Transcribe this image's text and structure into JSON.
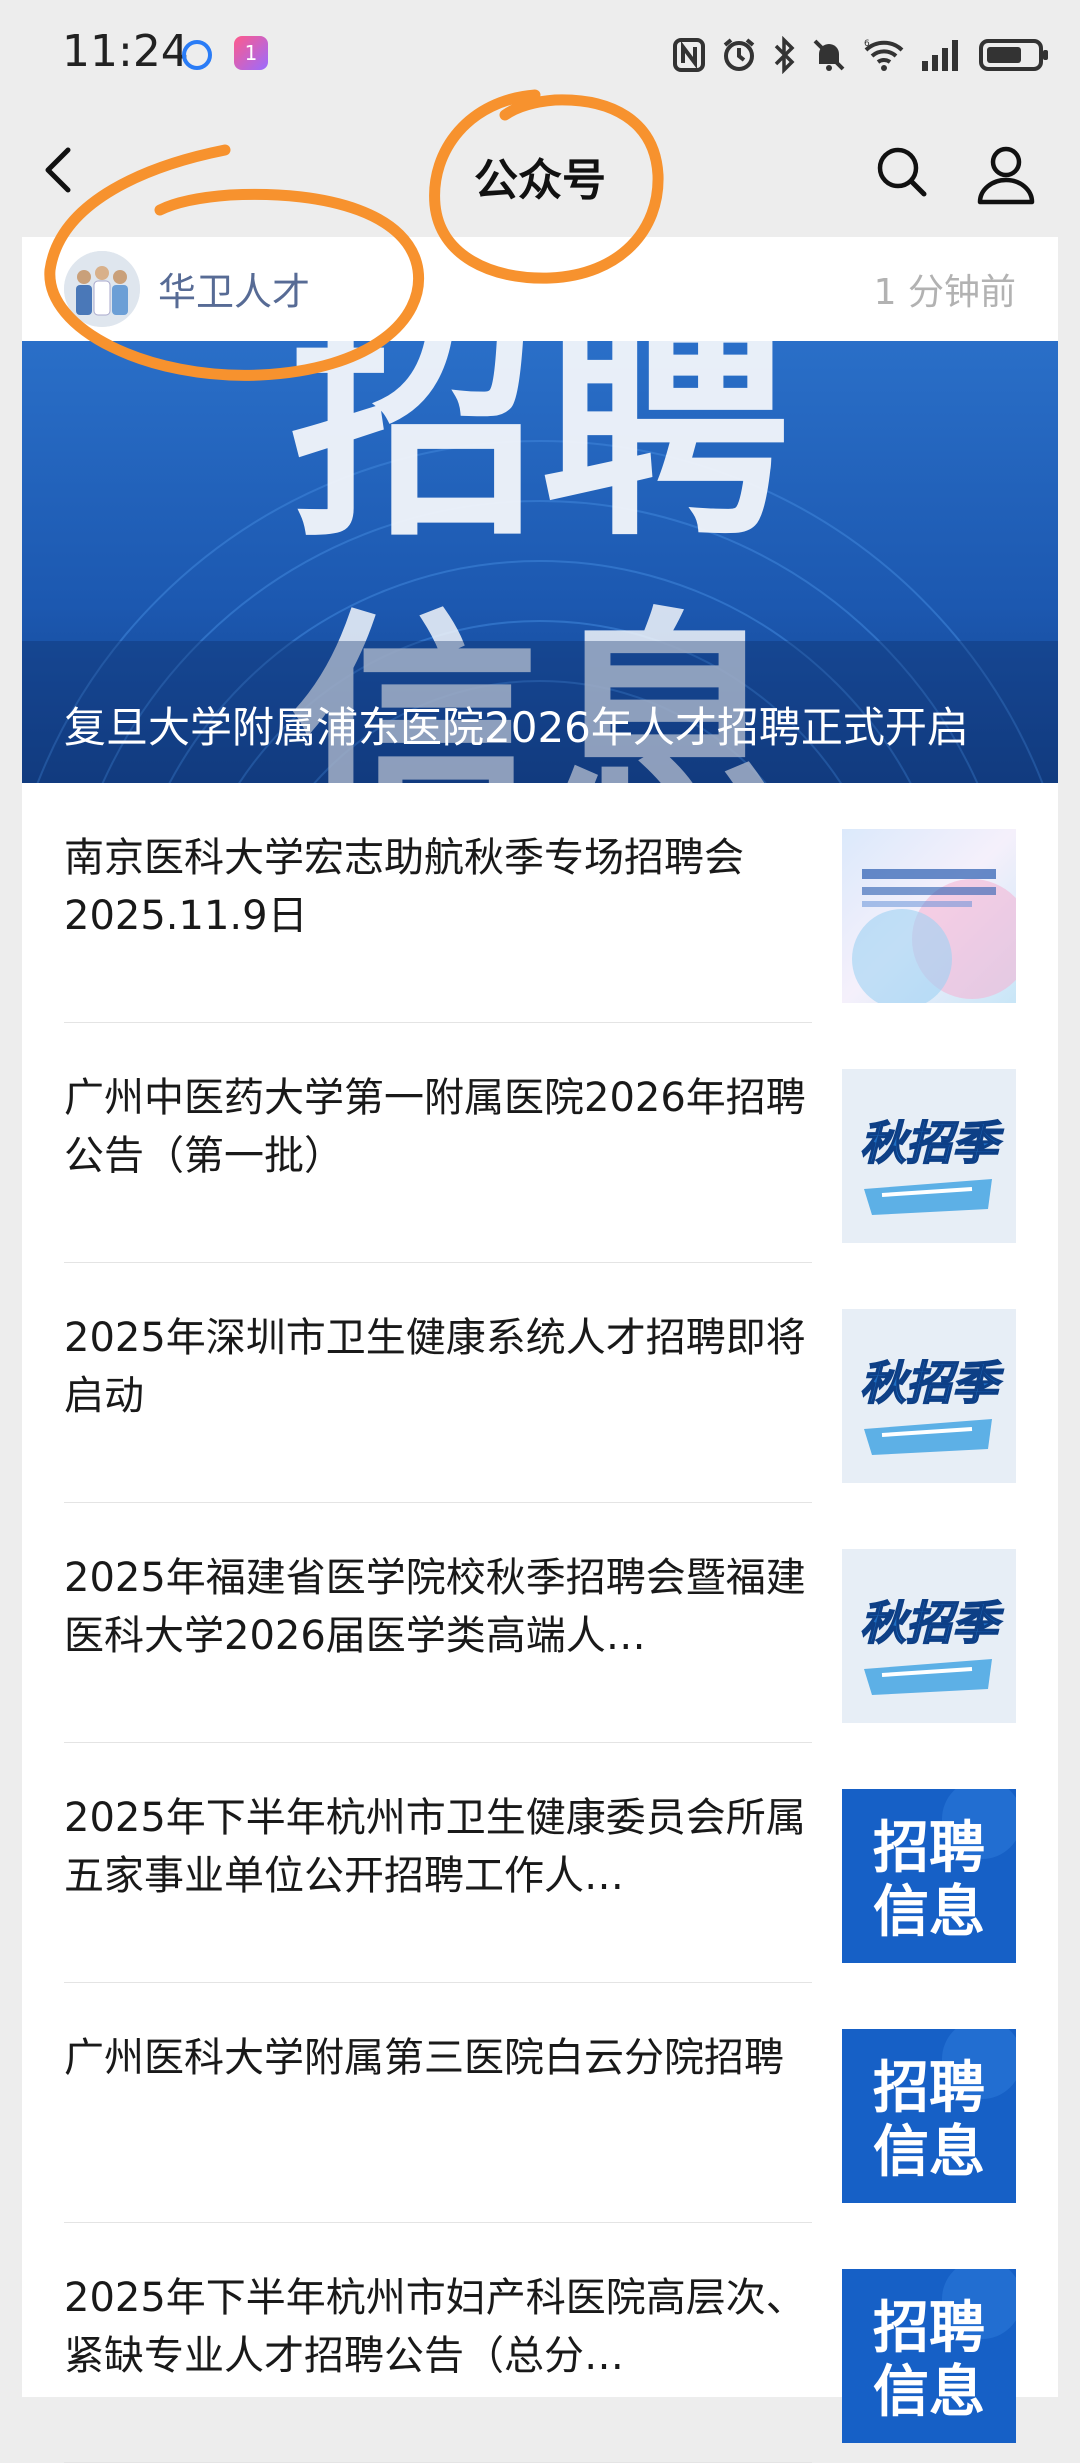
{
  "status_bar": {
    "time": "11:24"
  },
  "nav": {
    "title": "公众号"
  },
  "account": {
    "name": "华卫人才",
    "time": "1 分钟前"
  },
  "hero": {
    "title": "复旦大学附属浦东医院2026年人才招聘正式开启",
    "bg_text": "招聘信息"
  },
  "articles": [
    {
      "title": "南京医科大学宏志助航秋季专场招聘会2025.11.9日",
      "thumb": "poster"
    },
    {
      "title": "广州中医药大学第一附属医院2026年招聘公告（第一批）",
      "thumb": "autumn",
      "thumb_text": "秋招季"
    },
    {
      "title": "2025年深圳市卫生健康系统人才招聘即将启动",
      "thumb": "autumn",
      "thumb_text": "秋招季"
    },
    {
      "title": "2025年福建省医学院校秋季招聘会暨福建医科大学2026届医学类高端人…",
      "thumb": "autumn",
      "thumb_text": "秋招季"
    },
    {
      "title": "2025年下半年杭州市卫生健康委员会所属五家事业单位公开招聘工作人…",
      "thumb": "recruit",
      "thumb_text": "招聘信息"
    },
    {
      "title": "广州医科大学附属第三医院白云分院招聘",
      "thumb": "recruit",
      "thumb_text": "招聘信息"
    },
    {
      "title": "2025年下半年杭州市妇产科医院高层次、紧缺专业人才招聘公告（总分…",
      "thumb": "recruit",
      "thumb_text": "招聘信息"
    }
  ],
  "colors": {
    "annotation": "#f7922e",
    "account_name": "#576b95",
    "hero_blue": "#1c58b0"
  }
}
